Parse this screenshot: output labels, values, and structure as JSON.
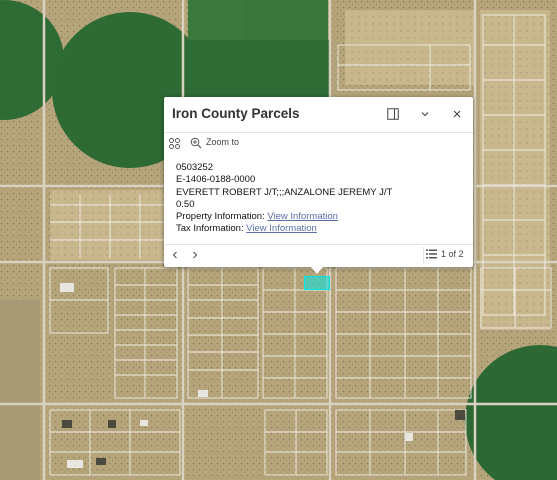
{
  "popup": {
    "title": "Iron County Parcels",
    "actions": {
      "zoom_to": "Zoom to"
    },
    "fields": {
      "parcel_id": "0503252",
      "account": "E-1406-0188-0000",
      "owner": "EVERETT ROBERT J/T;;;ANZALONE JEREMY J/T",
      "acres": "0.50",
      "property_label": "Property Information:",
      "property_link": "View Information",
      "tax_label": "Tax Information:",
      "tax_link": "View Information"
    },
    "pager": {
      "text": "1 of 2"
    }
  },
  "icons": {
    "dock": "dock-icon",
    "collapse": "chevron-down-icon",
    "close": "close-icon",
    "grid": "grid-icon",
    "zoom": "zoom-in-icon",
    "prev": "chevron-left-icon",
    "next": "chevron-right-icon",
    "list": "list-icon"
  },
  "colors": {
    "map_soil": "#b8a77e",
    "map_dry": "#c9b98f",
    "field_green": "#2f6b35",
    "parcel_line": "#f2f0ea",
    "highlight": "#00e5e5"
  }
}
